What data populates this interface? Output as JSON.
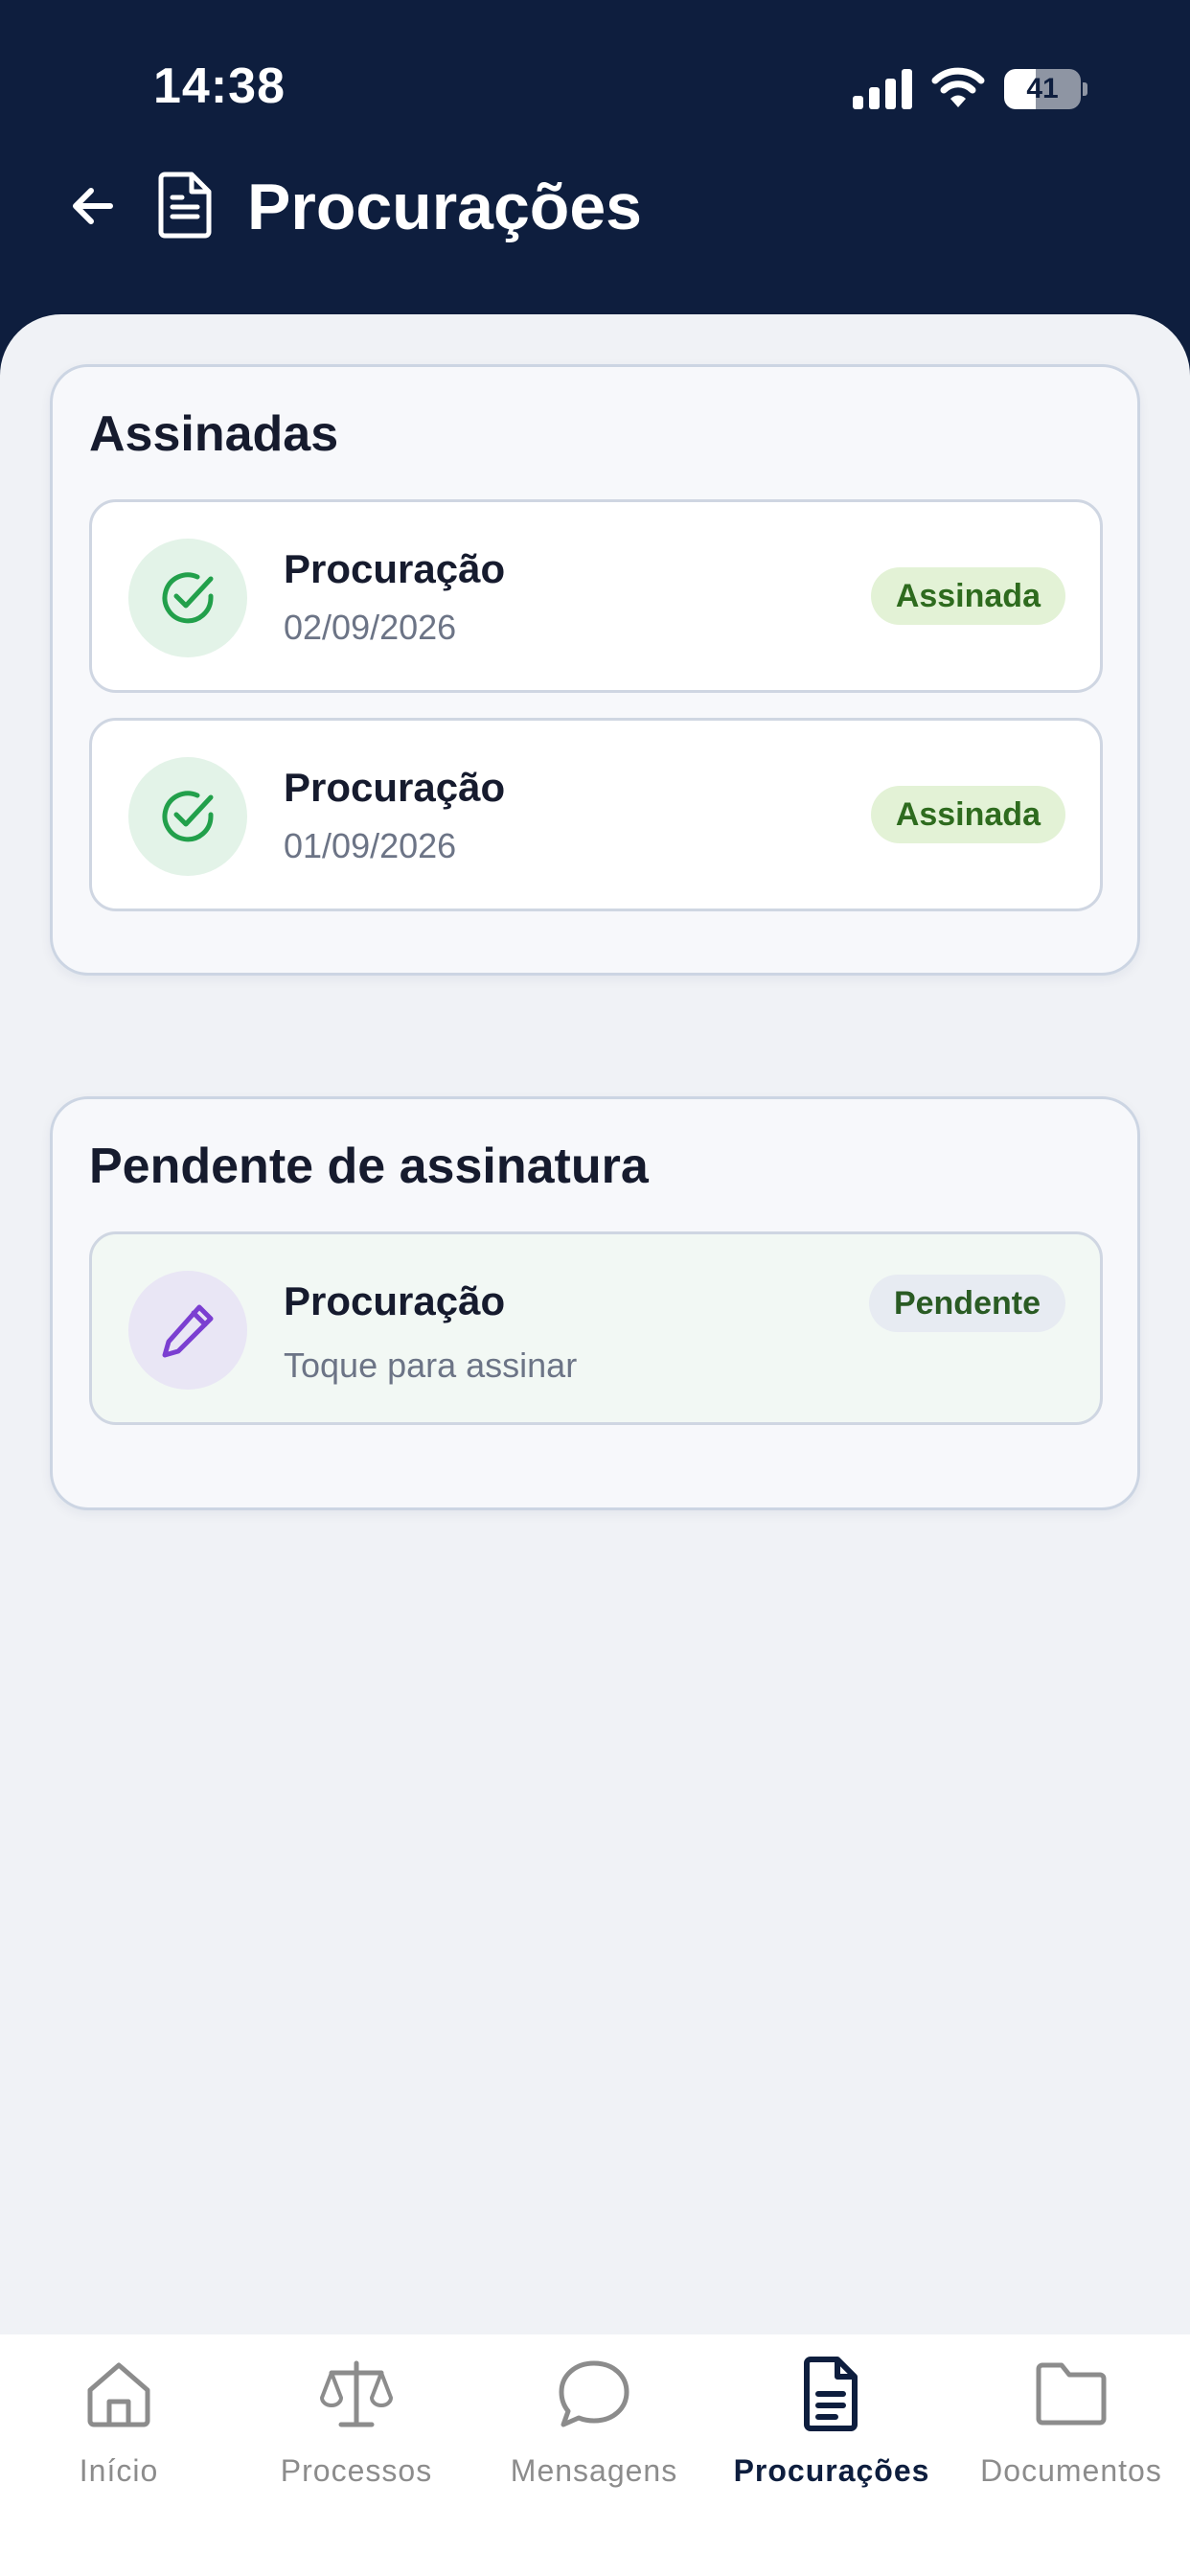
{
  "status_bar": {
    "time": "14:38",
    "battery_level": "41",
    "battery_fraction": 0.41
  },
  "header": {
    "title": "Procurações",
    "back_icon": "arrow-left-icon",
    "title_icon": "document-icon"
  },
  "sections": {
    "signed": {
      "title": "Assinadas",
      "items": [
        {
          "title": "Procuração",
          "date": "02/09/2026",
          "badge": "Assinada",
          "icon": "check-circle-icon"
        },
        {
          "title": "Procuração",
          "date": "01/09/2026",
          "badge": "Assinada",
          "icon": "check-circle-icon"
        }
      ]
    },
    "pending": {
      "title": "Pendente de assinatura",
      "items": [
        {
          "title": "Procuração",
          "subtitle": "Toque para assinar",
          "badge": "Pendente",
          "icon": "pencil-icon"
        }
      ]
    }
  },
  "bottom_nav": {
    "tabs": [
      {
        "label": "Início",
        "icon": "home-icon"
      },
      {
        "label": "Processos",
        "icon": "scale-icon"
      },
      {
        "label": "Mensagens",
        "icon": "chat-bubble-icon"
      },
      {
        "label": "Procurações",
        "icon": "document-icon",
        "active": true
      },
      {
        "label": "Documentos",
        "icon": "folder-icon"
      }
    ]
  },
  "colors": {
    "header_bg": "#0E1E3E",
    "screen_bg": "#F0F2F6",
    "signed_green": "#22A04B",
    "pending_purple": "#7B3FD1",
    "inactive_tab": "#8C8C8C"
  }
}
